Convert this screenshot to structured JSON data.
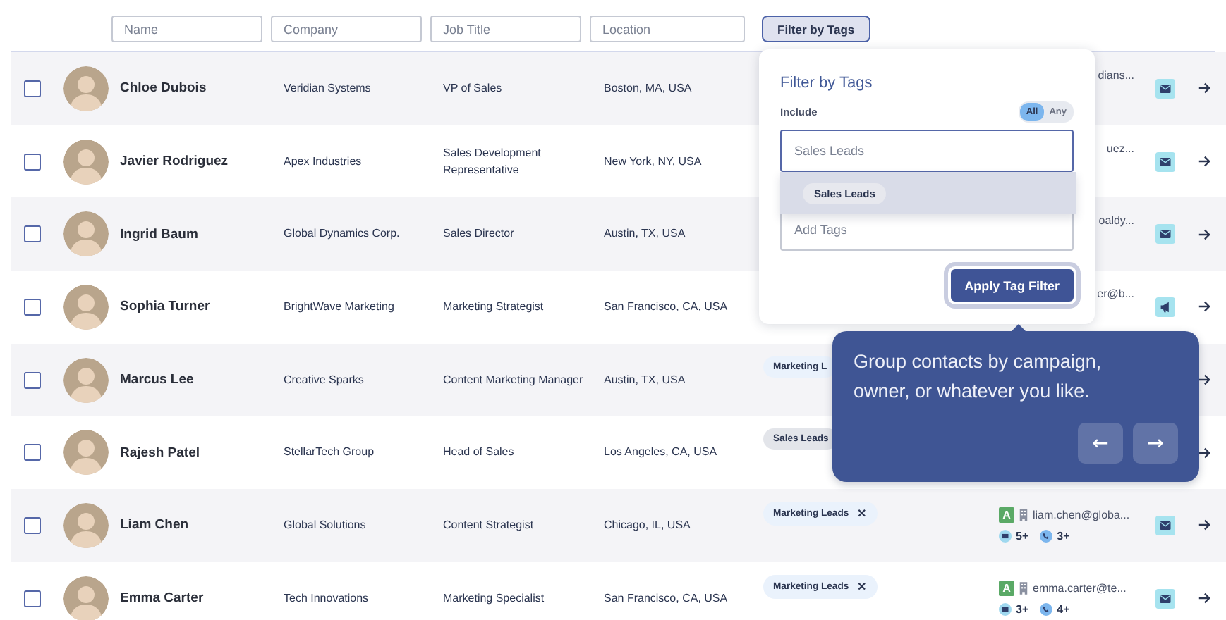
{
  "filters": {
    "fields": [
      {
        "placeholder": "Name"
      },
      {
        "placeholder": "Company"
      },
      {
        "placeholder": "Job Title"
      },
      {
        "placeholder": "Location"
      }
    ],
    "tag_button": {
      "label": "Filter by Tags",
      "active": true
    }
  },
  "rows": [
    {
      "checked": false,
      "name": "Chloe Dubois",
      "company": "Veridian Systems",
      "title": "VP of Sales",
      "location": "Boston, MA, USA",
      "contact": {
        "email": "dians..."
      },
      "action": {
        "kind": "mail"
      }
    },
    {
      "checked": false,
      "name": "Javier Rodriguez",
      "company": "Apex Industries",
      "title": "Sales Development Representative",
      "location": "New York, NY, USA",
      "contact": {
        "email": "uez..."
      },
      "action": {
        "kind": "mail"
      }
    },
    {
      "checked": false,
      "name": "Ingrid Baum",
      "company": "Global Dynamics Corp.",
      "title": "Sales Director",
      "location": "Austin, TX, USA",
      "contact": {
        "email": "oaldy..."
      },
      "action": {
        "kind": "mail"
      }
    },
    {
      "checked": false,
      "name": "Sophia Turner",
      "company": "BrightWave Marketing",
      "title": "Marketing Strategist",
      "location": "San Francisco, CA, USA",
      "contact": {
        "email": "er@b..."
      },
      "action": {
        "kind": "megaphone"
      }
    },
    {
      "checked": false,
      "name": "Marcus Lee",
      "company": "Creative Sparks",
      "title": "Content Marketing Manager",
      "location": "Austin, TX, USA",
      "tags": [
        {
          "label": "Marketing L",
          "color": "#eaf2fc"
        }
      ]
    },
    {
      "checked": false,
      "name": "Rajesh Patel",
      "company": "StellarTech Group",
      "title": "Head of Sales",
      "location": "Los Angeles, CA, USA",
      "tags": [
        {
          "label": "Sales Leads",
          "color": "#e3e5ea"
        }
      ]
    },
    {
      "checked": false,
      "name": "Liam Chen",
      "company": "Global Solutions",
      "title": "Content Strategist",
      "location": "Chicago, IL, USA",
      "tags": [
        {
          "label": "Marketing Leads",
          "color": "#eaf2fc",
          "remove": "✕"
        }
      ],
      "contact": {
        "badge": "A",
        "email": "liam.chen@globa...",
        "emails": "5+",
        "phones": "3+"
      },
      "action": {
        "kind": "mail"
      }
    },
    {
      "checked": false,
      "name": "Emma Carter",
      "company": "Tech Innovations",
      "title": "Marketing Specialist",
      "location": "San Francisco, CA, USA",
      "tags": [
        {
          "label": "Marketing Leads",
          "color": "#eaf2fc",
          "remove": "✕"
        }
      ],
      "contact": {
        "badge": "A",
        "email": "emma.carter@te...",
        "emails": "3+",
        "phones": "4+"
      },
      "action": {
        "kind": "mail"
      }
    }
  ],
  "popover": {
    "title": "Filter by Tags",
    "include_label": "Include",
    "modes": [
      {
        "label": "All",
        "selected": true
      },
      {
        "label": "Any",
        "selected": false
      }
    ],
    "search": {
      "placeholder": "Sales Leads"
    },
    "suggestions": [
      {
        "label": "Sales Leads",
        "selected": true
      }
    ],
    "add_field": {
      "placeholder": "Add Tags"
    },
    "apply": "Apply Tag Filter"
  },
  "tooltip": {
    "text": "Group contacts by campaign, owner, or whatever you like.",
    "prev": "←",
    "next": "→"
  }
}
